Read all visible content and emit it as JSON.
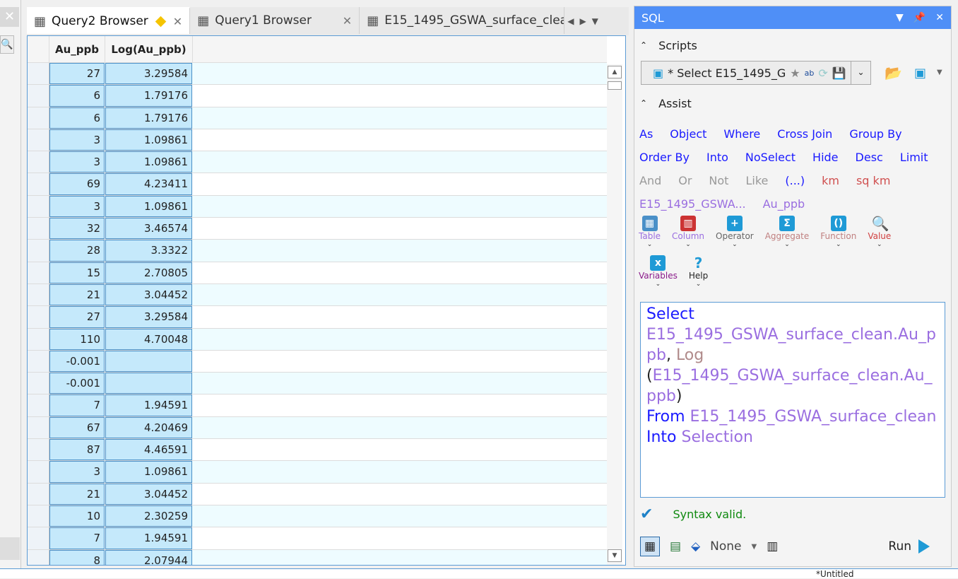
{
  "tabs": [
    {
      "label": "Query2 Browser",
      "modified": true
    },
    {
      "label": "Query1 Browser"
    },
    {
      "label": "E15_1495_GSWA_surface_clea"
    }
  ],
  "grid": {
    "columns": [
      "Au_ppb",
      "Log(Au_ppb)"
    ],
    "rows": [
      [
        "27",
        "3.29584"
      ],
      [
        "6",
        "1.79176"
      ],
      [
        "6",
        "1.79176"
      ],
      [
        "3",
        "1.09861"
      ],
      [
        "3",
        "1.09861"
      ],
      [
        "69",
        "4.23411"
      ],
      [
        "3",
        "1.09861"
      ],
      [
        "32",
        "3.46574"
      ],
      [
        "28",
        "3.3322"
      ],
      [
        "15",
        "2.70805"
      ],
      [
        "21",
        "3.04452"
      ],
      [
        "27",
        "3.29584"
      ],
      [
        "110",
        "4.70048"
      ],
      [
        "-0.001",
        ""
      ],
      [
        "-0.001",
        ""
      ],
      [
        "7",
        "1.94591"
      ],
      [
        "67",
        "4.20469"
      ],
      [
        "87",
        "4.46591"
      ],
      [
        "3",
        "1.09861"
      ],
      [
        "21",
        "3.04452"
      ],
      [
        "10",
        "2.30259"
      ],
      [
        "7",
        "1.94591"
      ],
      [
        "8",
        "2.07944"
      ]
    ]
  },
  "sql": {
    "title": "SQL",
    "scripts_label": "Scripts",
    "script_value": "* Select E15_1495_G",
    "assist_label": "Assist",
    "keywords_row1": [
      "As",
      "Object",
      "Where",
      "Cross Join",
      "Group By"
    ],
    "keywords_row2": [
      "Order By",
      "Into",
      "NoSelect",
      "Hide",
      "Desc",
      "Limit"
    ],
    "operators": [
      "And",
      "Or",
      "Not",
      "Like"
    ],
    "paren": "(...)",
    "units": [
      "km",
      "sq km"
    ],
    "fields": [
      "E15_1495_GSWA...",
      "Au_ppb"
    ],
    "tools": [
      "Table",
      "Column",
      "Operator",
      "Aggregate",
      "Function",
      "Value",
      "Variables",
      "Help"
    ],
    "query": {
      "select": "Select",
      "field": "E15_1495_GSWA_surface_clean.Au_ppb",
      "comma": ",",
      "log": "Log",
      "open": "(",
      "field2": "E15_1495_GSWA_surface_clean.Au_ppb",
      "close": ")",
      "from": "From",
      "table": "E15_1495_GSWA_surface_clean",
      "into": "Into",
      "target": "Selection"
    },
    "status": "Syntax valid.",
    "symbology": "None",
    "run_label": "Run"
  },
  "statusbar": "*Untitled"
}
